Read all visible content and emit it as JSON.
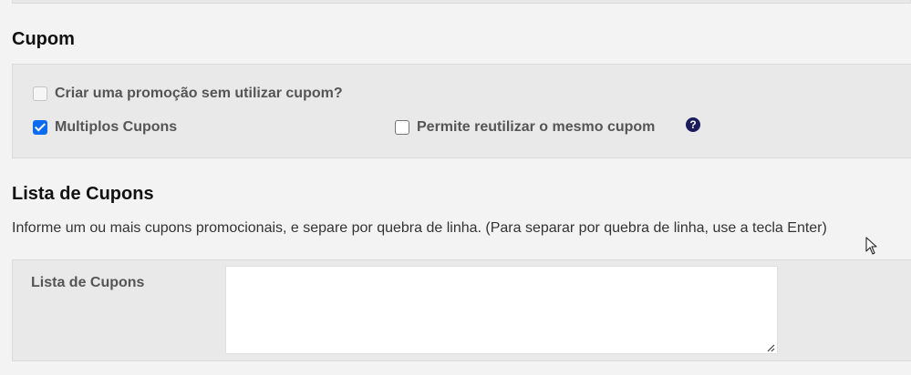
{
  "sections": {
    "cupom": {
      "title": "Cupom",
      "checkboxes": [
        {
          "label": "Criar uma promoção sem utilizar cupom?",
          "checked": false,
          "disabled": true
        },
        {
          "label": "Multiplos Cupons",
          "checked": true,
          "disabled": false
        },
        {
          "label": "Permite reutilizar o mesmo cupom",
          "checked": false,
          "disabled": false
        }
      ],
      "help_icon": "question-circle-icon",
      "help_glyph": "?"
    },
    "lista": {
      "title": "Lista de Cupons",
      "description": "Informe um ou mais cupons promocionais, e separe por quebra de linha. (Para separar por quebra de linha, use a tecla Enter)",
      "field_label": "Lista de Cupons",
      "field_value": ""
    }
  },
  "colors": {
    "checkbox_checked": "#0b6cf0",
    "help_icon_bg": "#1b1d5c"
  }
}
